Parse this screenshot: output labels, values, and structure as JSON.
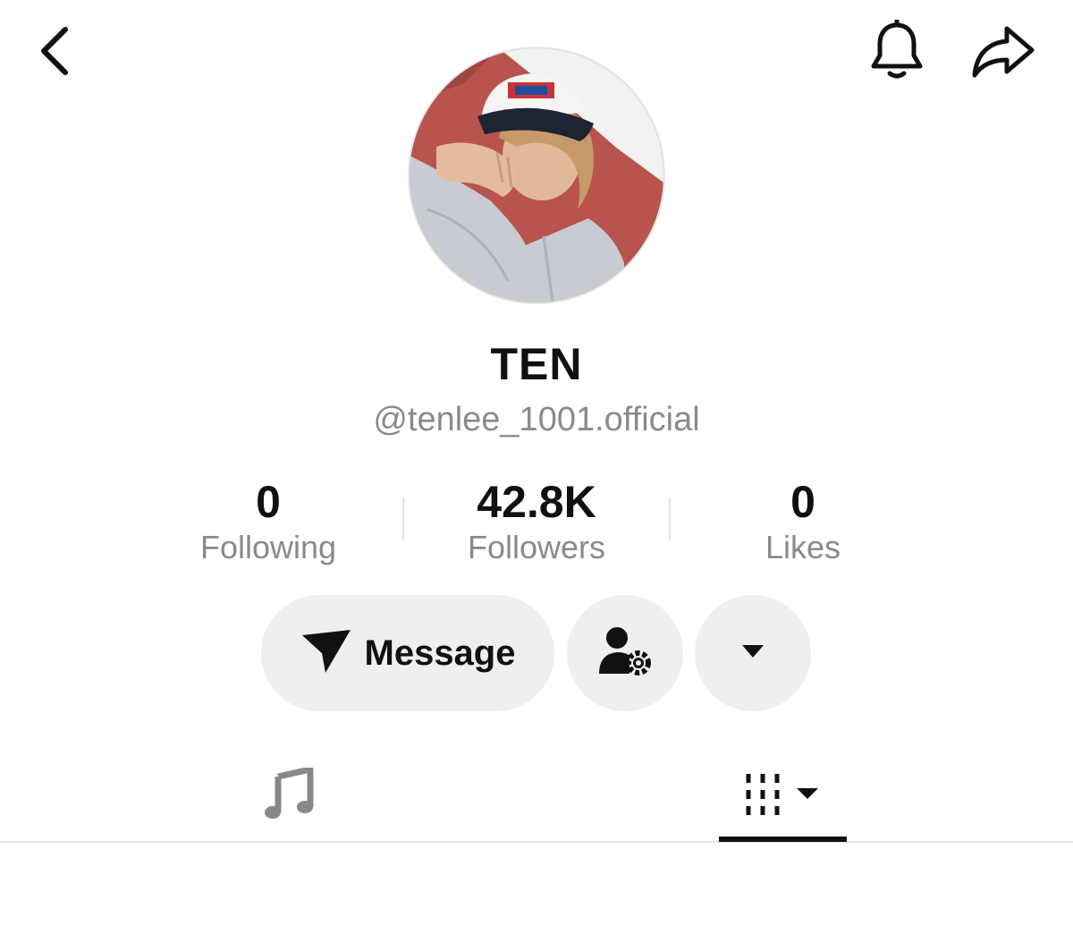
{
  "top_bar": {
    "back_icon": "chevron-left-icon",
    "notification_icon": "bell-icon",
    "share_icon": "share-arrow-icon"
  },
  "profile": {
    "avatar": "profile-photo",
    "display_name": "TEN",
    "handle": "@tenlee_1001.official"
  },
  "stats": [
    {
      "value": "0",
      "label": "Following"
    },
    {
      "value": "42.8K",
      "label": "Followers"
    },
    {
      "value": "0",
      "label": "Likes"
    }
  ],
  "actions": {
    "message_label": "Message",
    "message_icon": "send-arrow-icon",
    "follow_settings_icon": "user-gear-icon",
    "more_icon": "caret-down-icon"
  },
  "tabs": [
    {
      "icon": "music-note-icon",
      "active": false
    },
    {
      "icon": "grid-bars-icon",
      "active": true
    }
  ],
  "colors": {
    "text_primary": "#111111",
    "text_secondary": "#8a8a8a",
    "button_bg": "#efefef",
    "divider": "#e6e6e6"
  }
}
